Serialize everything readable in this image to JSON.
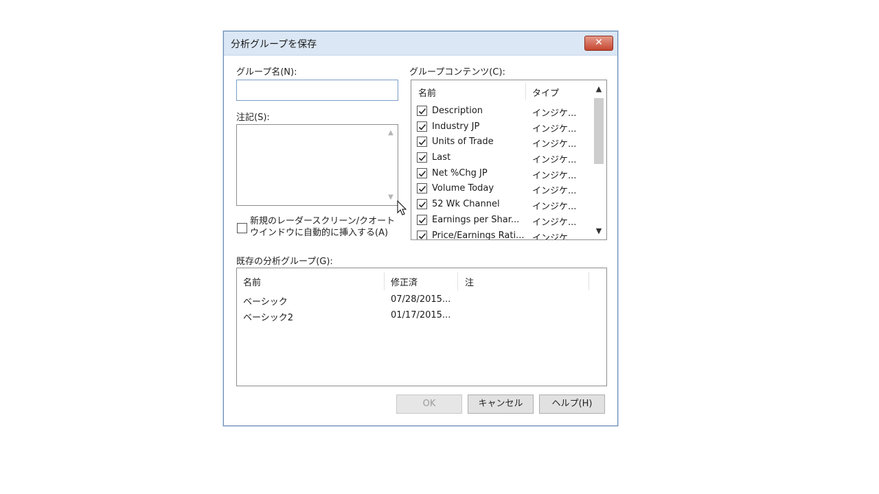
{
  "dialog": {
    "title": "分析グループを保存",
    "close_label": "✕"
  },
  "group_name": {
    "label": "グループ名(N):",
    "value": ""
  },
  "memo": {
    "label": "注記(S):",
    "value": ""
  },
  "auto_insert": {
    "label_line1": "新規のレーダースクリーン/クオート",
    "label_line2": "ウインドウに自動的に挿入する(A)",
    "checked": false
  },
  "group_contents": {
    "label": "グループコンテンツ(C):",
    "columns": [
      "名前",
      "タイプ"
    ],
    "rows": [
      {
        "name": "Description",
        "type": "インジケ...",
        "checked": true
      },
      {
        "name": "Industry JP",
        "type": "インジケ...",
        "checked": true
      },
      {
        "name": "Units of Trade",
        "type": "インジケ...",
        "checked": true
      },
      {
        "name": "Last",
        "type": "インジケ...",
        "checked": true
      },
      {
        "name": "Net %Chg JP",
        "type": "インジケ...",
        "checked": true
      },
      {
        "name": "Volume Today",
        "type": "インジケ...",
        "checked": true
      },
      {
        "name": "52 Wk Channel",
        "type": "インジケ...",
        "checked": true
      },
      {
        "name": "Earnings per Shar...",
        "type": "インジケ...",
        "checked": true
      },
      {
        "name": "Price/Earnings Rati...",
        "type": "インジケ...",
        "checked": true
      }
    ]
  },
  "existing_groups": {
    "label": "既存の分析グループ(G):",
    "columns": [
      "名前",
      "修正済",
      "注"
    ],
    "rows": [
      {
        "name": "ベーシック",
        "modified": "07/28/2015...",
        "note": ""
      },
      {
        "name": "ベーシック2",
        "modified": "01/17/2015...",
        "note": ""
      }
    ]
  },
  "buttons": {
    "ok": "OK",
    "cancel": "キャンセル",
    "help": "ヘルプ(H)"
  },
  "icons": {
    "close": "close-icon",
    "check": "check-icon",
    "scroll_up": "chevron-up-icon",
    "scroll_down": "chevron-down-icon",
    "cursor": "mouse-cursor-icon"
  }
}
